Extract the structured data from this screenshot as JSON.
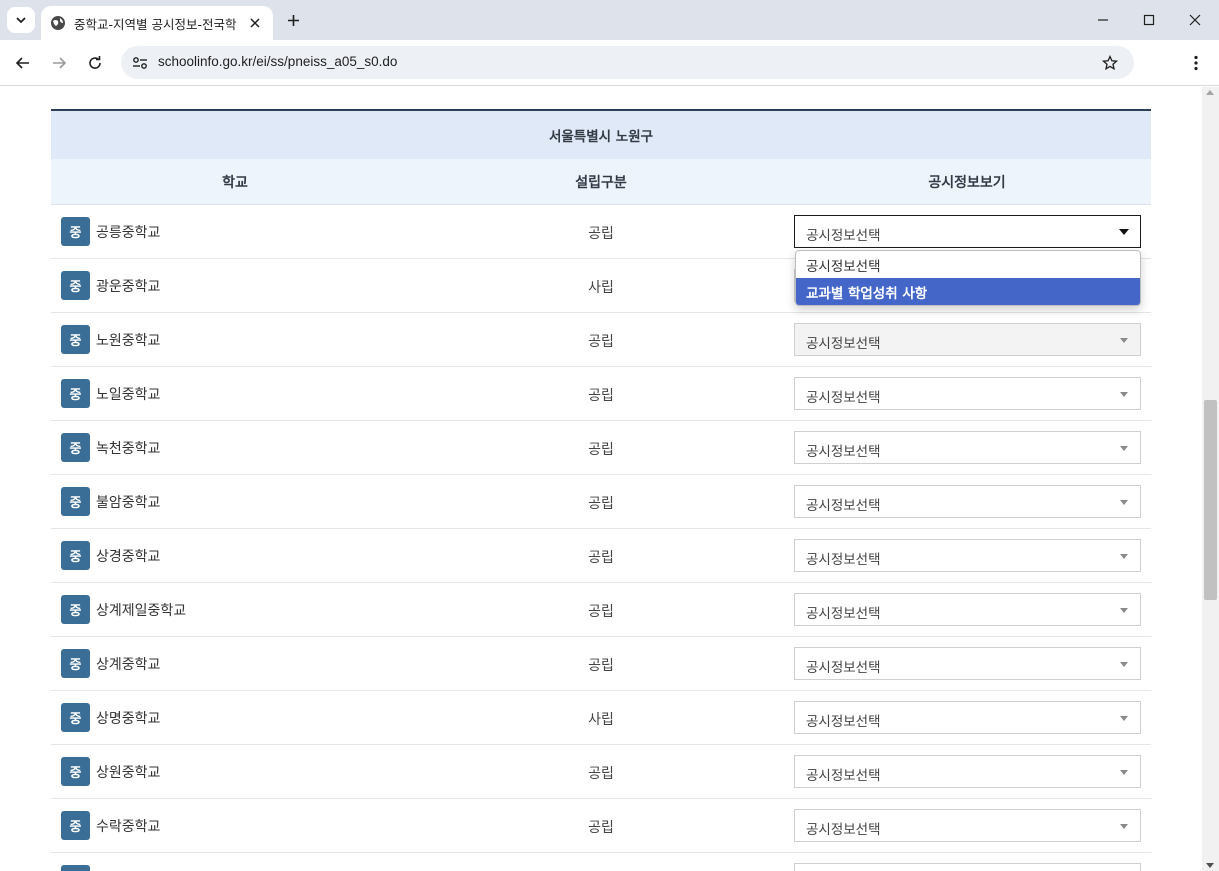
{
  "browser": {
    "tab_title": "중학교-지역별 공시정보-전국학",
    "url": "schoolinfo.go.kr/ei/ss/pneiss_a05_s0.do"
  },
  "table": {
    "region_title": "서울특별시 노원구",
    "headers": [
      "학교",
      "설립구분",
      "공시정보보기"
    ],
    "badge_label": "중",
    "select_placeholder": "공시정보선택",
    "rows": [
      {
        "school": "공릉중학교",
        "type": "공립"
      },
      {
        "school": "광운중학교",
        "type": "사립"
      },
      {
        "school": "노원중학교",
        "type": "공립"
      },
      {
        "school": "노일중학교",
        "type": "공립"
      },
      {
        "school": "녹천중학교",
        "type": "공립"
      },
      {
        "school": "불암중학교",
        "type": "공립"
      },
      {
        "school": "상경중학교",
        "type": "공립"
      },
      {
        "school": "상계제일중학교",
        "type": "공립"
      },
      {
        "school": "상계중학교",
        "type": "공립"
      },
      {
        "school": "상명중학교",
        "type": "사립"
      },
      {
        "school": "상원중학교",
        "type": "공립"
      },
      {
        "school": "수락중학교",
        "type": "공립"
      }
    ]
  },
  "dropdown": {
    "options": [
      "공시정보선택",
      "교과별 학업성취 사항"
    ],
    "highlighted_option": "교과별 학업성취 사항"
  },
  "colors": {
    "badge": "#3b6e96",
    "header_bg": "#eef4fc",
    "region_bg": "#dfe9f7",
    "dropdown_highlight": "#4466c9"
  }
}
